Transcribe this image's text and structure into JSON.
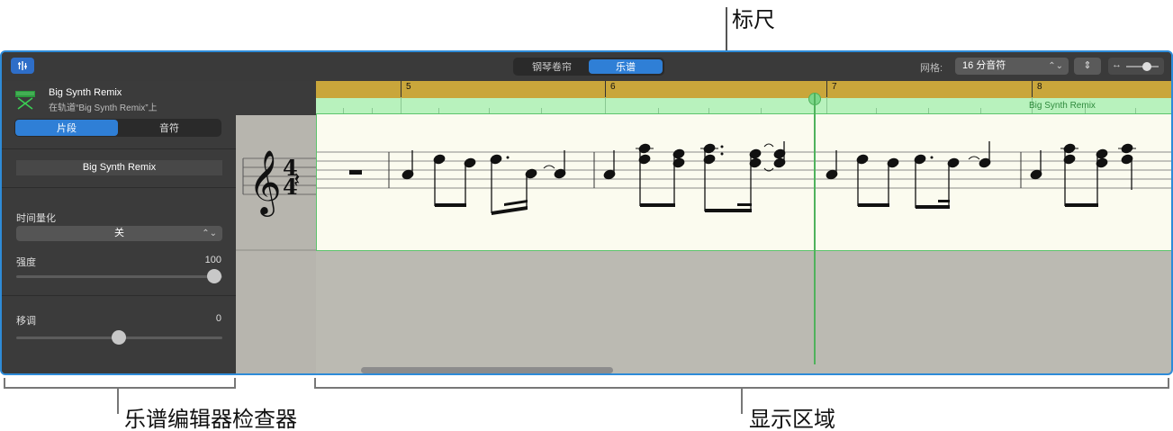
{
  "callouts": {
    "ruler": "标尺",
    "inspector": "乐谱编辑器检查器",
    "display": "显示区域"
  },
  "toolbar": {
    "view_tabs": [
      "钢琴卷帘",
      "乐谱"
    ],
    "active_tab": "乐谱",
    "grid_label": "网格:",
    "grid_value": "16 分音符"
  },
  "inspector": {
    "region_name": "Big Synth Remix",
    "region_track": "在轨道“Big Synth Remix”上",
    "mode_tabs": [
      "片段",
      "音符"
    ],
    "active_mode": "片段",
    "name_field": "Big Synth Remix",
    "quantize_label": "时间量化",
    "quantize_value": "关",
    "strength_label": "强度",
    "strength_value": "100",
    "transpose_label": "移调",
    "transpose_value": "0"
  },
  "ruler": {
    "bars": [
      "5",
      "6",
      "7",
      "8"
    ]
  },
  "region_bar": {
    "label": "Big Synth Remix"
  },
  "score": {
    "time_signature_top": "4",
    "time_signature_bottom": "4"
  },
  "colors": {
    "window_border": "#2e8bd8",
    "ruler": "#c9a63b",
    "region": "#b8f2bd",
    "staff_bg": "#fbfbef",
    "accent": "#2f7fd6"
  }
}
